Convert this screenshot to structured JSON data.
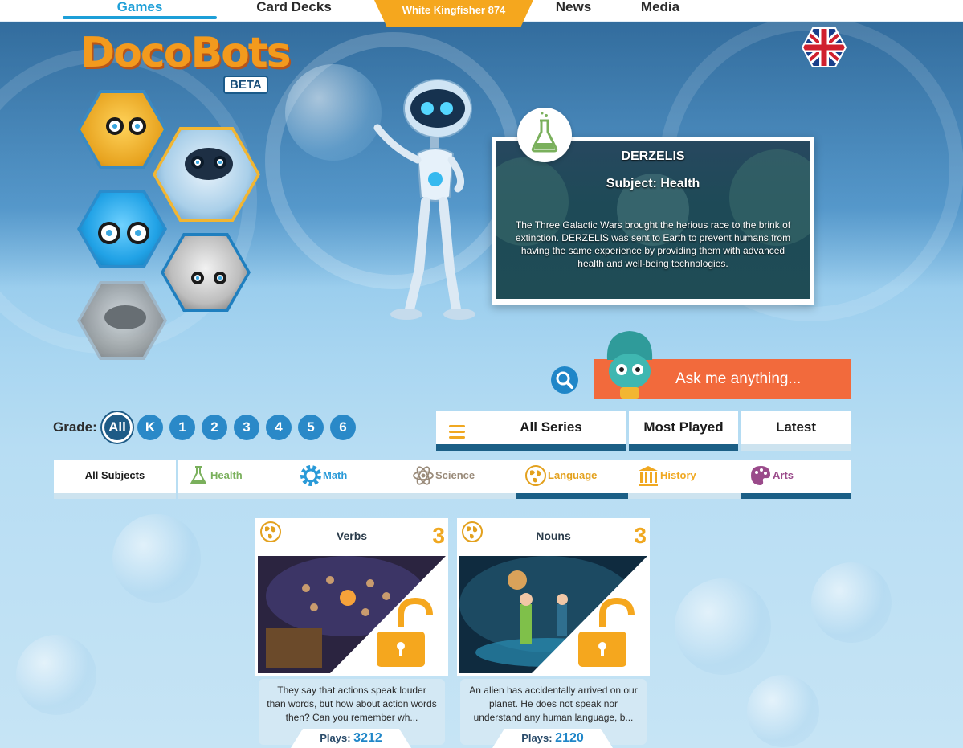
{
  "nav": {
    "tabs": [
      {
        "label": "Games",
        "active": true
      },
      {
        "label": "Card Decks",
        "active": false
      },
      {
        "label": "News",
        "active": false
      },
      {
        "label": "Media",
        "active": false
      }
    ],
    "user_badge": "White Kingfisher 874"
  },
  "logo": {
    "text": "DocoBots",
    "badge": "BETA"
  },
  "language_flag": "uk-flag-icon",
  "featured_bot": {
    "name": "DERZELIS",
    "subject": "Subject: Health",
    "description": "The Three Galactic Wars brought the herious race to the brink of extinction. DERZELIS was sent to Earth to prevent humans from having the same experience by providing them with advanced health and well-being technologies.",
    "badge_icon": "flask-icon"
  },
  "search": {
    "placeholder": "Ask me anything..."
  },
  "grade": {
    "label": "Grade:",
    "options": [
      "All",
      "K",
      "1",
      "2",
      "3",
      "4",
      "5",
      "6"
    ],
    "selected": "All"
  },
  "series_tabs": [
    {
      "label": "All Series",
      "active": true
    },
    {
      "label": "Most Played",
      "active": true
    },
    {
      "label": "Latest",
      "active": false
    }
  ],
  "subjects": [
    {
      "label": "All Subjects",
      "color": "#1a1a1a",
      "icon": "none",
      "active": false
    },
    {
      "label": "Health",
      "color": "#7ab05c",
      "icon": "flask-icon",
      "active": false
    },
    {
      "label": "Math",
      "color": "#2a9ad8",
      "icon": "gear-icon",
      "active": false
    },
    {
      "label": "Science",
      "color": "#9a8b7a",
      "icon": "atom-icon",
      "active": false
    },
    {
      "label": "Language",
      "color": "#e3a11e",
      "icon": "globe-icon",
      "active": true
    },
    {
      "label": "History",
      "color": "#f0a821",
      "icon": "columns-icon",
      "active": false
    },
    {
      "label": "Arts",
      "color": "#9a4a8a",
      "icon": "palette-icon",
      "active": true
    }
  ],
  "cards": [
    {
      "title": "Verbs",
      "level": "3",
      "description": "They say that actions speak louder than words, but how about action words then? Can you remember wh...",
      "plays_label": "Plays:",
      "plays": "3212",
      "locked": true
    },
    {
      "title": "Nouns",
      "level": "3",
      "description": "An alien has accidentally arrived on our planet. He does not speak nor understand any human language, b...",
      "plays_label": "Plays:",
      "plays": "2120",
      "locked": true
    }
  ],
  "colors": {
    "accent_blue": "#1d9fd8",
    "orange": "#f26a3c",
    "gold": "#f5a71e",
    "dark_blue": "#1b5f86"
  }
}
